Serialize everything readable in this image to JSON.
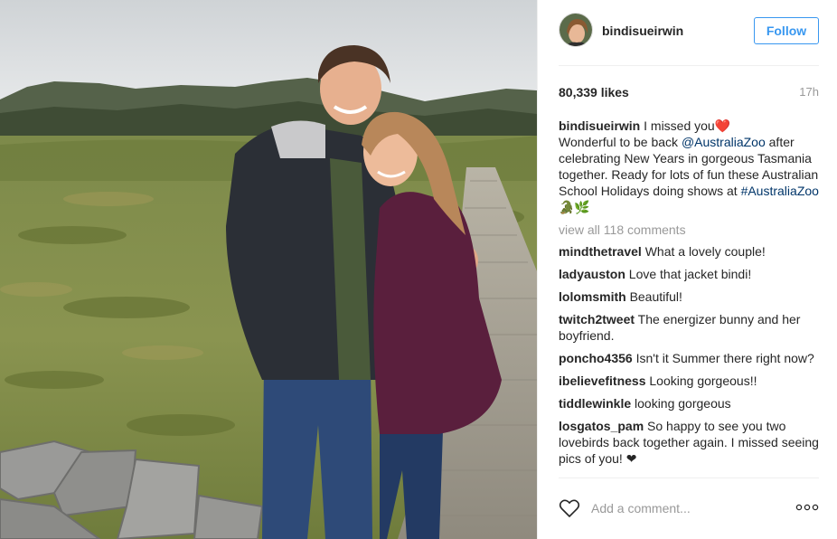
{
  "post": {
    "username": "bindisueirwin",
    "follow_label": "Follow",
    "likes": "80,339 likes",
    "time": "17h"
  },
  "caption": {
    "user": "bindisueirwin",
    "text_1": " I missed you",
    "text_2": "Wonderful to be back ",
    "mention": "@AustraliaZoo",
    "text_3": " after celebrating New Years in gorgeous Tasmania together. Ready for lots of fun these Australian School Holidays doing shows at ",
    "hashtag": "#AustraliaZoo",
    "emoji": " 🐊🌿"
  },
  "view_all": "view all 118 comments",
  "comments": [
    {
      "user": "mindthetravel",
      "text": "What a lovely couple!"
    },
    {
      "user": "ladyauston",
      "text": "Love that jacket bindi!"
    },
    {
      "user": "lolomsmith",
      "text": "Beautiful!"
    },
    {
      "user": "twitch2tweet",
      "text": "The energizer bunny and her boyfriend."
    },
    {
      "user": "poncho4356",
      "text": "Isn't it Summer there right now?"
    },
    {
      "user": "ibelievefitness",
      "text": "Looking gorgeous!!"
    },
    {
      "user": "tiddlewinkle",
      "text": "looking gorgeous"
    },
    {
      "user": "losgatos_pam",
      "text": "So happy to see you two lovebirds back together again. I missed seeing pics of you! ❤"
    }
  ],
  "footer": {
    "placeholder": "Add a comment..."
  },
  "icons": {
    "heart": "heart-outline",
    "more": "three-dots",
    "caption_heart": "❤️"
  },
  "colors": {
    "accent": "#3897f0",
    "mention": "#003569",
    "muted": "#999999"
  }
}
